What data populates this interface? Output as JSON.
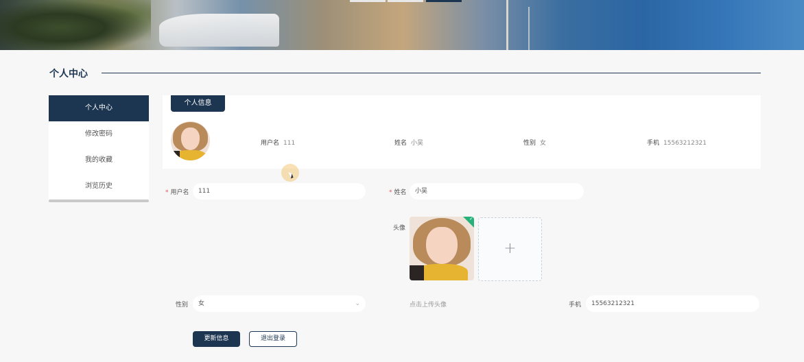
{
  "section": {
    "title": "个人中心"
  },
  "sidebar": {
    "items": [
      {
        "label": "个人中心",
        "active": true
      },
      {
        "label": "修改密码",
        "active": false
      },
      {
        "label": "我的收藏",
        "active": false
      },
      {
        "label": "浏览历史",
        "active": false
      }
    ]
  },
  "profile_card": {
    "tab_label": "个人信息",
    "username_label": "用户名",
    "username": "111",
    "name_label": "姓名",
    "name": "小吴",
    "gender_label": "性别",
    "gender": "女",
    "phone_label": "手机",
    "phone": "15563212321"
  },
  "form": {
    "username_label": "用户名",
    "username_value": "111",
    "name_label": "姓名",
    "name_value": "小吴",
    "avatar_label": "头像",
    "avatar_hint": "点击上传头像",
    "gender_label": "性别",
    "gender_value": "女",
    "phone_label": "手机",
    "phone_value": "15563212321",
    "required_mark": "*",
    "upload_plus": "+"
  },
  "buttons": {
    "update": "更新信息",
    "logout": "退出登录"
  },
  "colors": {
    "primary": "#1c3550",
    "required": "#e05555",
    "success": "#26b27a"
  }
}
